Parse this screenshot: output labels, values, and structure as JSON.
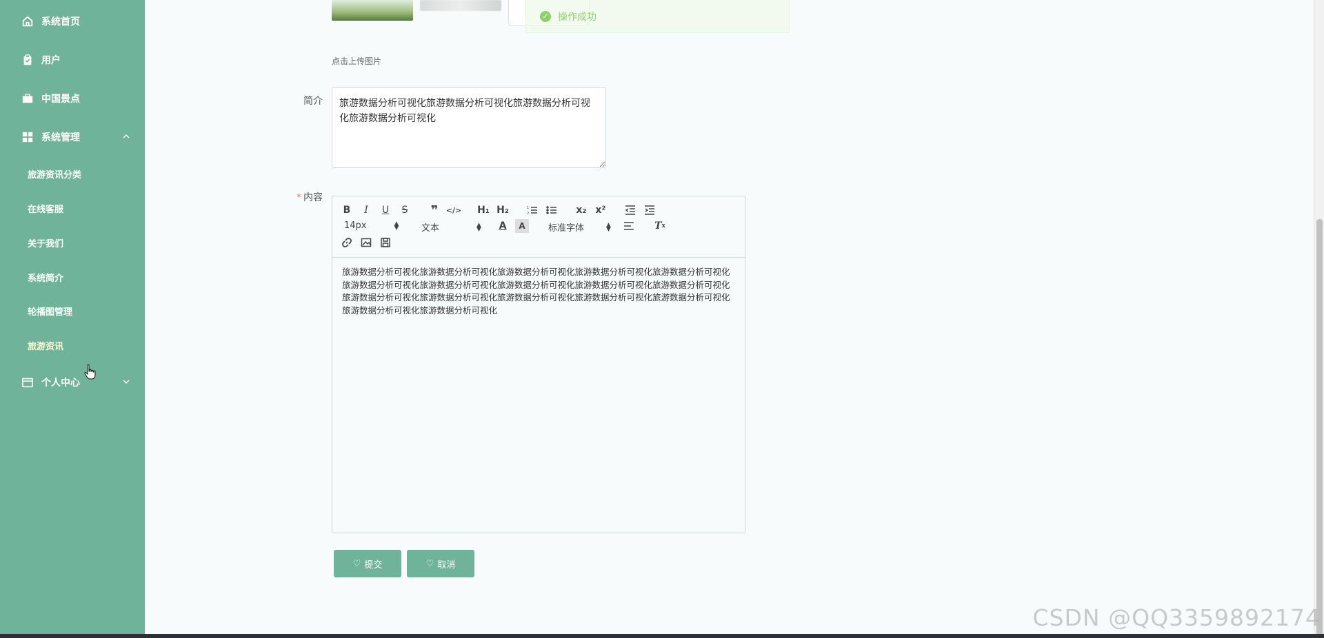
{
  "sidebar": {
    "items": [
      {
        "label": "系统首页",
        "icon": "home-icon"
      },
      {
        "label": "用户",
        "icon": "clipboard-icon"
      },
      {
        "label": "中国景点",
        "icon": "briefcase-icon"
      },
      {
        "label": "系统管理",
        "icon": "grid-icon",
        "expanded": true
      },
      {
        "label": "个人中心",
        "icon": "card-icon",
        "expanded": false
      }
    ],
    "submenu": [
      {
        "label": "旅游资讯分类"
      },
      {
        "label": "在线客服"
      },
      {
        "label": "关于我们"
      },
      {
        "label": "系统简介"
      },
      {
        "label": "轮播图管理"
      },
      {
        "label": "旅游资讯",
        "active": true
      }
    ]
  },
  "toast": {
    "message": "操作成功"
  },
  "form": {
    "upload_hint": "点击上传图片",
    "intro_label": "简介",
    "intro_value": "旅游数据分析可视化旅游数据分析可视化旅游数据分析可视化旅游数据分析可视化",
    "content_label": "内容",
    "content_required_mark": "*",
    "content_value": "旅游数据分析可视化旅游数据分析可视化旅游数据分析可视化旅游数据分析可视化旅游数据分析可视化旅游数据分析可视化旅游数据分析可视化旅游数据分析可视化旅游数据分析可视化旅游数据分析可视化旅游数据分析可视化旅游数据分析可视化旅游数据分析可视化旅游数据分析可视化旅游数据分析可视化旅游数据分析可视化旅游数据分析可视化"
  },
  "editor": {
    "font_size": "14px",
    "block_format": "文本",
    "font_family": "标准字体",
    "buttons": {
      "bold": "B",
      "italic": "I",
      "underline": "U",
      "strike": "S",
      "h1": "H₁",
      "h2": "H₂",
      "sub": "x₂",
      "sup": "x²"
    }
  },
  "buttons": {
    "submit": "提交",
    "cancel": "取消"
  },
  "watermark": "CSDN @QQ3359892174",
  "colors": {
    "sidebar": "#6fb49a",
    "success": "#67c23a",
    "required": "#f56c6c"
  }
}
